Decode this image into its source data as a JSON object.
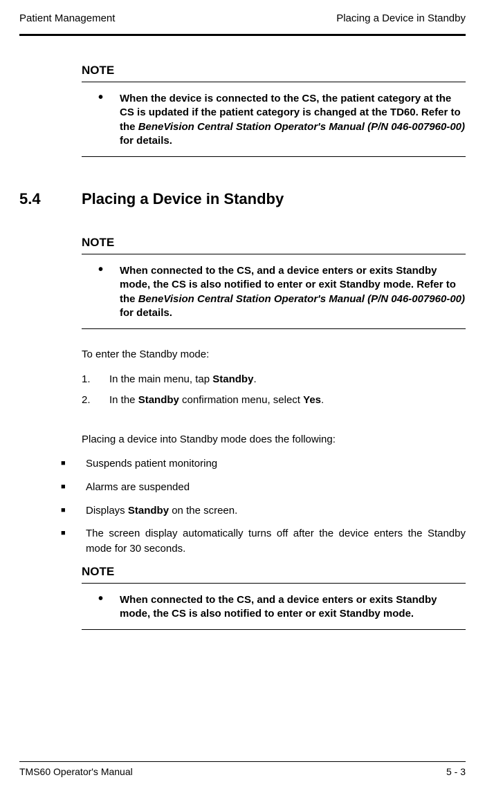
{
  "header": {
    "left": "Patient Management",
    "right": "Placing a Device in Standby"
  },
  "note1": {
    "label": "NOTE",
    "bullet": "•",
    "text_a": "When the device is connected to the CS, the patient category at the CS is updated if the patient category is changed at the TD60. Refer to the ",
    "text_ital": "BeneVision Central Station Operator's Manual (P/N 046-007960-00)",
    "text_b": " for details."
  },
  "section": {
    "num": "5.4",
    "title": "Placing a Device in Standby"
  },
  "note2": {
    "label": "NOTE",
    "bullet": "•",
    "text_a": "When connected to the CS, and a device enters or exits Standby mode, the CS is also notified to enter or exit Standby mode. Refer to the ",
    "text_ital": "BeneVision Central Station Operator's Manual (P/N 046-007960-00)",
    "text_b": " for details."
  },
  "intro": "To enter the Standby mode:",
  "steps": [
    {
      "n": "1.",
      "pre": "In the main menu, tap ",
      "bold": "Standby",
      "post": "."
    },
    {
      "n": "2.",
      "pre": "In the ",
      "bold": "Standby",
      "mid": " confirmation menu, select ",
      "bold2": "Yes",
      "post": "."
    }
  ],
  "intro2": "Placing a device into Standby mode does the following:",
  "bullets": [
    {
      "sq": "■",
      "text": "Suspends patient monitoring"
    },
    {
      "sq": "■",
      "text": "Alarms are suspended"
    },
    {
      "sq": "■",
      "pre": "Displays ",
      "bold": "Standby",
      "post": " on the screen."
    },
    {
      "sq": "■",
      "text": "The screen display automatically turns off after the device enters the Standby mode for 30 seconds."
    }
  ],
  "note3": {
    "label": "NOTE",
    "bullet": "•",
    "text": "When connected to the CS, and a device enters or exits Standby mode, the CS is also notified to enter or exit Standby mode."
  },
  "footer": {
    "left": "TMS60 Operator's Manual",
    "right": "5 - 3"
  }
}
